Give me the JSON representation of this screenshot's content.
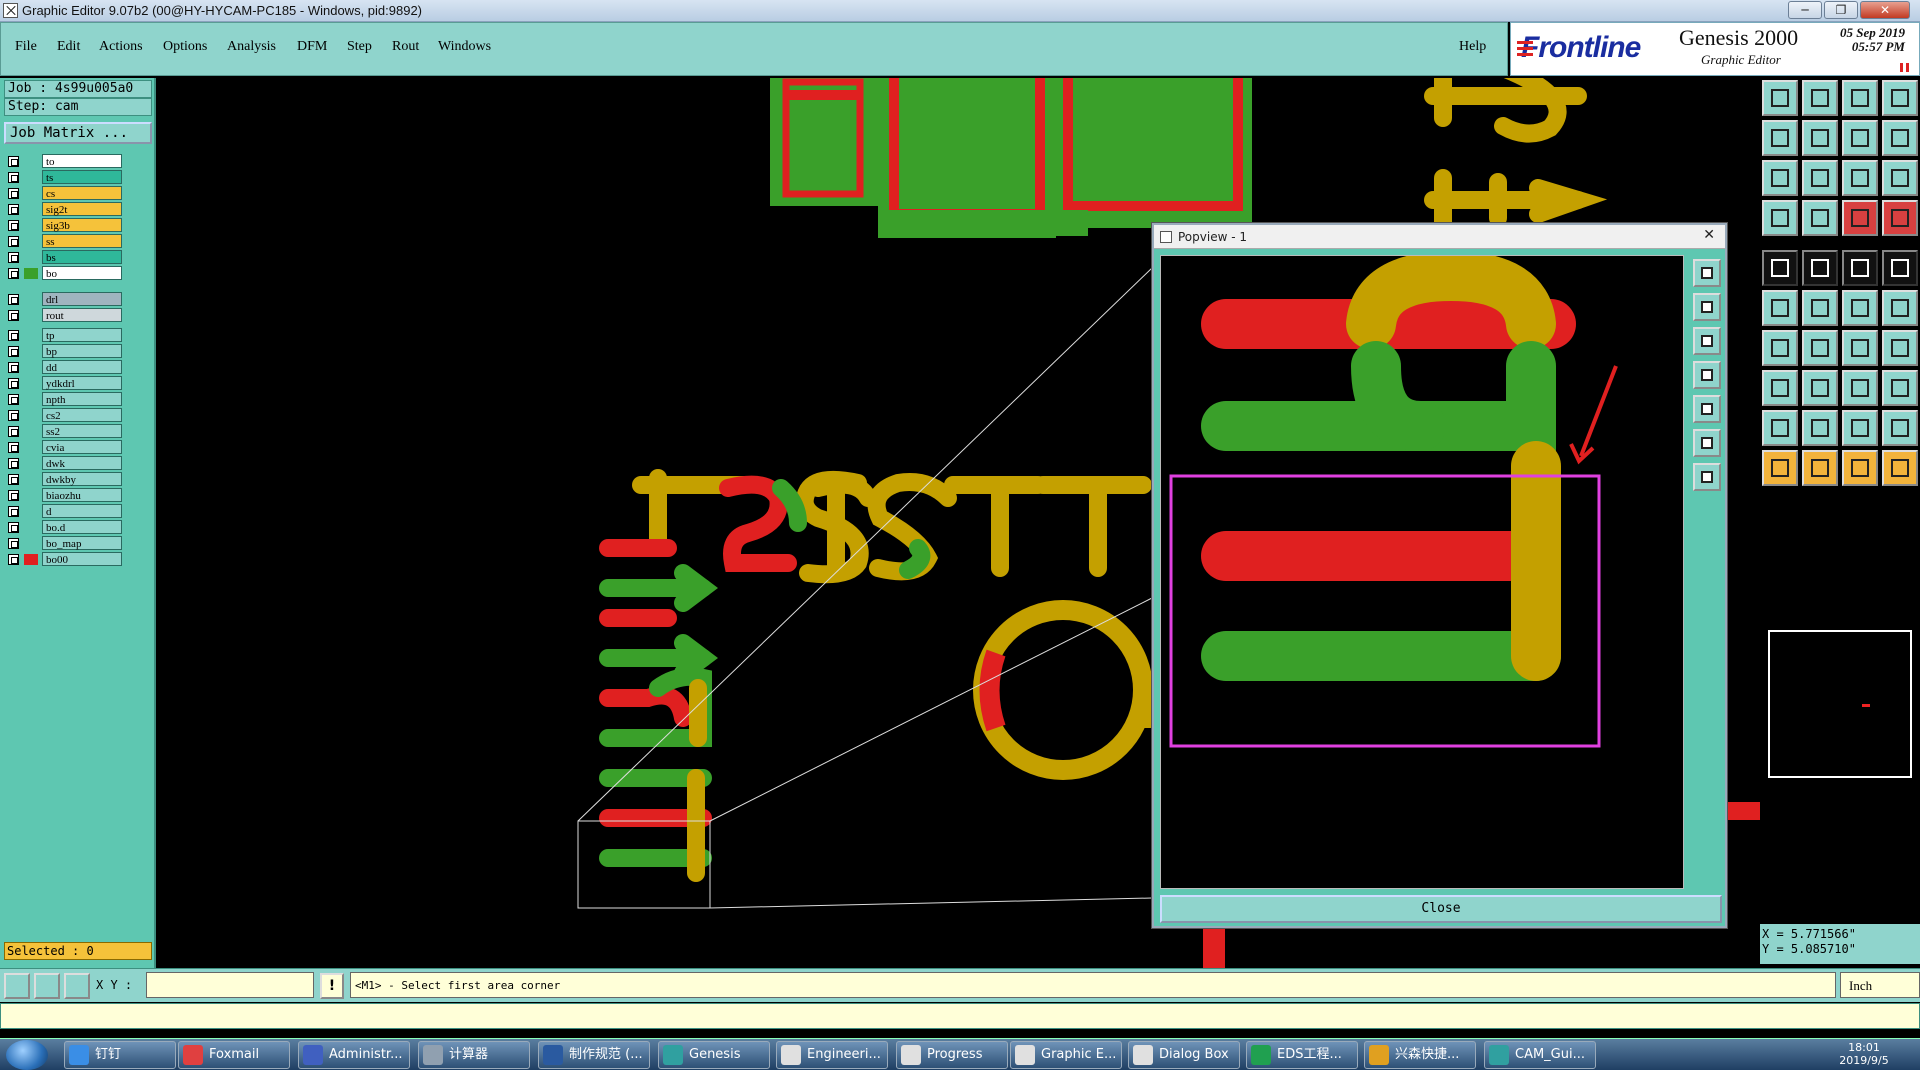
{
  "window": {
    "title": "Graphic Editor 9.07b2 (00@HY-HYCAM-PC185 - Windows, pid:9892)",
    "minimize_label": "─",
    "restore_label": "❐",
    "close_label": "✕"
  },
  "menubar": {
    "items": [
      "File",
      "Edit",
      "Actions",
      "Options",
      "Analysis",
      "DFM",
      "Step",
      "Rout",
      "Windows"
    ],
    "help": "Help"
  },
  "brand": {
    "logo": "Frontline",
    "product": "Genesis 2000",
    "subtitle": "Graphic Editor",
    "date": "05 Sep 2019",
    "time": "05:57 PM"
  },
  "left_panel": {
    "job": "Job : 4s99u005a0",
    "step": "Step: cam",
    "job_matrix": "Job Matrix ...",
    "layers_group1": [
      {
        "name": "to",
        "color": "#ffffff",
        "swatch": "",
        "mark": "✎"
      },
      {
        "name": "ts",
        "color": "#2fb89a",
        "swatch": "",
        "mark": ""
      },
      {
        "name": "cs",
        "color": "#f5c23a",
        "swatch": "",
        "mark": ""
      },
      {
        "name": "sig2t",
        "color": "#f5c23a",
        "swatch": "",
        "mark": ""
      },
      {
        "name": "sig3b",
        "color": "#f5c23a",
        "swatch": "",
        "mark": ""
      },
      {
        "name": "ss",
        "color": "#f5c23a",
        "swatch": "",
        "mark": ""
      },
      {
        "name": "bs",
        "color": "#2fb89a",
        "swatch": "",
        "mark": ""
      },
      {
        "name": "bo",
        "color": "#ffffff",
        "swatch": "#3aa02a",
        "mark": "✎■"
      }
    ],
    "layers_group2": [
      {
        "name": "drl",
        "color": "#9fb4bf",
        "swatch": "",
        "mark": ""
      },
      {
        "name": "rout",
        "color": "#cfd8dc",
        "swatch": "",
        "mark": ""
      }
    ],
    "layers_group3": [
      {
        "name": "tp",
        "color": "#8fd4cc",
        "swatch": "",
        "mark": ""
      },
      {
        "name": "bp",
        "color": "#8fd4cc",
        "swatch": "",
        "mark": ""
      },
      {
        "name": "dd",
        "color": "#8fd4cc",
        "swatch": "",
        "mark": ""
      },
      {
        "name": "ydkdrl",
        "color": "#8fd4cc",
        "swatch": "",
        "mark": ""
      },
      {
        "name": "npth",
        "color": "#8fd4cc",
        "swatch": "",
        "mark": ""
      },
      {
        "name": "cs2",
        "color": "#8fd4cc",
        "swatch": "",
        "mark": ""
      },
      {
        "name": "ss2",
        "color": "#8fd4cc",
        "swatch": "",
        "mark": ""
      },
      {
        "name": "cvia",
        "color": "#8fd4cc",
        "swatch": "",
        "mark": ""
      },
      {
        "name": "dwk",
        "color": "#8fd4cc",
        "swatch": "",
        "mark": ""
      },
      {
        "name": "dwkby",
        "color": "#8fd4cc",
        "swatch": "",
        "mark": ""
      },
      {
        "name": "biaozhu",
        "color": "#8fd4cc",
        "swatch": "",
        "mark": ""
      },
      {
        "name": "d",
        "color": "#8fd4cc",
        "swatch": "",
        "mark": ""
      },
      {
        "name": "bo.d",
        "color": "#8fd4cc",
        "swatch": "",
        "mark": "✎"
      },
      {
        "name": "bo_map",
        "color": "#8fd4cc",
        "swatch": "",
        "mark": ""
      },
      {
        "name": "bo00",
        "color": "#8fd4cc",
        "swatch": "#e02020",
        "mark": "✎"
      }
    ],
    "selected": "Selected : 0"
  },
  "popview": {
    "title": "Popview - 1",
    "close_x": "✕",
    "close_button": "Close"
  },
  "right_panel": {
    "x_coord": "X = 5.771566\"",
    "y_coord": "Y = 5.085710\""
  },
  "command_bar": {
    "xy_label": "X Y :",
    "xy_value": "",
    "info_label": "!",
    "message": "<M1> - Select first area corner",
    "unit": "Inch"
  },
  "taskbar": {
    "tasks": [
      {
        "label": "钉钉",
        "color": "#3a8ee6"
      },
      {
        "label": "Foxmail",
        "color": "#e04040"
      },
      {
        "label": "Administr...",
        "color": "#4060c0"
      },
      {
        "label": "计算器",
        "color": "#90a0b0"
      },
      {
        "label": "制作规范 (...",
        "color": "#2a5aa0"
      },
      {
        "label": "Genesis",
        "color": "#30a0a0"
      },
      {
        "label": "Engineeri...",
        "color": "#e0e0e0"
      },
      {
        "label": "Progress",
        "color": "#e0e0e0"
      },
      {
        "label": "Graphic E...",
        "color": "#e0e0e0"
      },
      {
        "label": "Dialog Box",
        "color": "#e0e0e0"
      },
      {
        "label": "EDS工程...",
        "color": "#20a050"
      },
      {
        "label": "兴森快捷...",
        "color": "#e0a020"
      },
      {
        "label": "CAM_Gui...",
        "color": "#30a0a0"
      }
    ],
    "clock_time": "18:01",
    "clock_date": "2019/9/5"
  }
}
